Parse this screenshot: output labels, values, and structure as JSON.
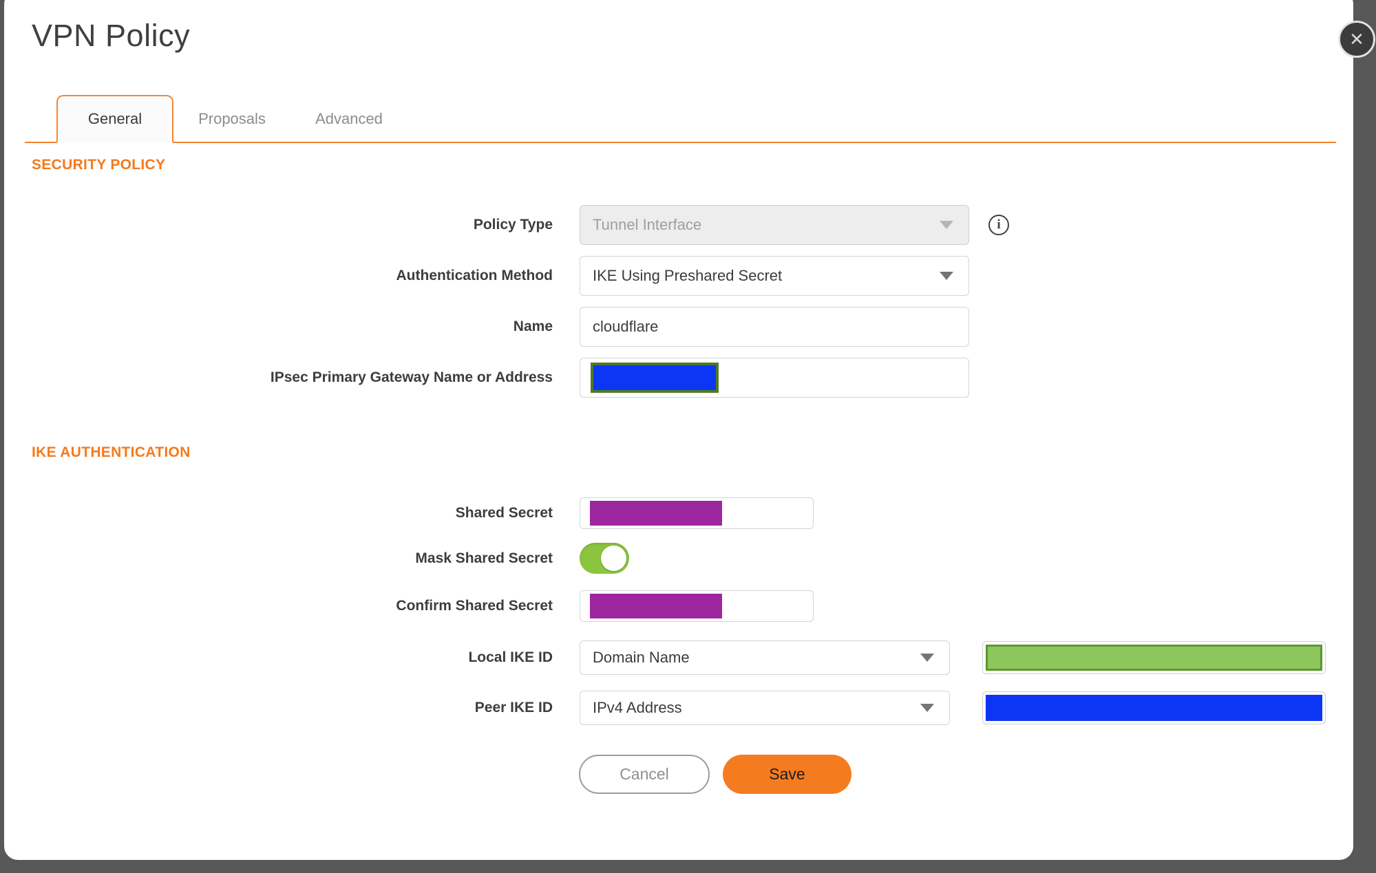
{
  "dialog": {
    "title": "VPN Policy"
  },
  "icons": {
    "close": "✕",
    "info": "i"
  },
  "tabs": {
    "general": "General",
    "proposals": "Proposals",
    "advanced": "Advanced"
  },
  "security_policy": {
    "heading": "SECURITY POLICY",
    "policy_type": {
      "label": "Policy Type",
      "value": "Tunnel Interface",
      "disabled": true
    },
    "authentication_method": {
      "label": "Authentication Method",
      "value": "IKE Using Preshared Secret"
    },
    "name": {
      "label": "Name",
      "value": "cloudflare"
    },
    "gateway": {
      "label": "IPsec Primary Gateway Name or Address",
      "value": "",
      "redacted": true
    }
  },
  "ike_authentication": {
    "heading": "IKE AUTHENTICATION",
    "shared_secret": {
      "label": "Shared Secret",
      "value": "",
      "redacted": true
    },
    "mask_shared_secret": {
      "label": "Mask Shared Secret",
      "state": "on"
    },
    "confirm_shared_secret": {
      "label": "Confirm Shared Secret",
      "value": "",
      "redacted": true
    },
    "local_ike_id": {
      "label": "Local IKE ID",
      "value": "Domain Name",
      "id_value_redacted": true
    },
    "peer_ike_id": {
      "label": "Peer IKE ID",
      "value": "IPv4 Address",
      "id_value_redacted": true
    }
  },
  "actions": {
    "cancel": "Cancel",
    "save": "Save"
  },
  "colors": {
    "accent_orange": "#f5791d",
    "tab_border_orange": "#f58634",
    "save_orange": "#f57b20",
    "toggle_green": "#8bc53e",
    "redaction_purple": "#9c27a0",
    "redaction_blue": "#0d36f4",
    "redaction_green_fill": "#8dc75b",
    "redaction_green_border": "#5d9630",
    "redaction_olive_border": "#4e7a27",
    "backdrop_gray": "#585858"
  }
}
